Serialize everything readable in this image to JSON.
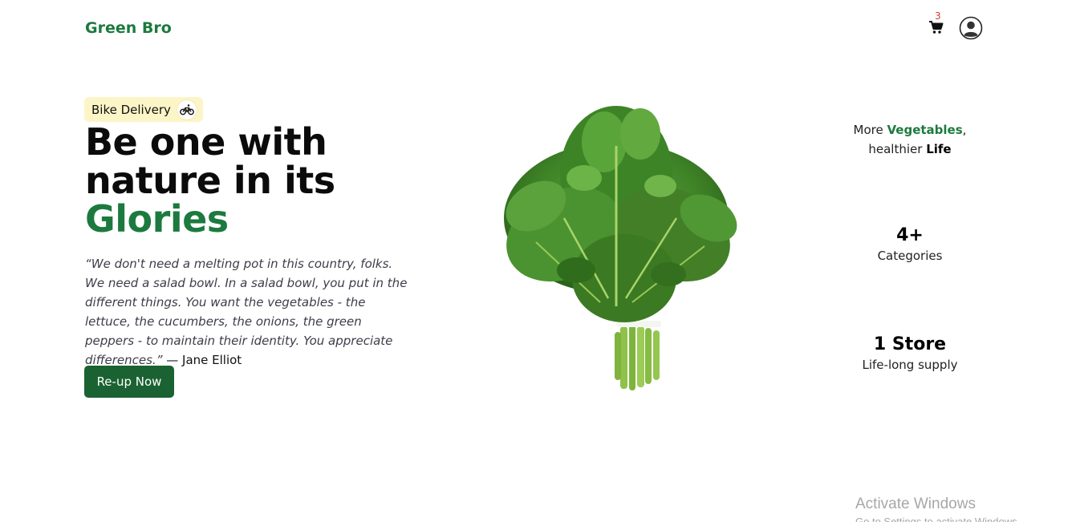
{
  "header": {
    "logo": "Green Bro",
    "cart_count": "3"
  },
  "hero": {
    "badge_label": "Bike Delivery",
    "headline_line1": "Be one with",
    "headline_line2": "nature in its",
    "headline_highlight": "Glories",
    "quote_text": "“We don't need a melting pot in this country, folks. We need a salad bowl. In a salad bowl, you put in the different things. You want the vegetables - the lettuce, the cucumbers, the onions, the green peppers - to maintain their identity. You appreciate differences.”",
    "quote_author": " — Jane Elliot",
    "cta_label": "Re-up Now"
  },
  "stats": {
    "tagline_pre": "More ",
    "tagline_veg": "Vegetables",
    "tagline_mid": ",",
    "tagline_line2": "healthier ",
    "tagline_life": "Life",
    "categories_value": "4+",
    "categories_label": "Categories",
    "store_value": "1 Store",
    "store_label": "Life-long supply"
  },
  "watermark": {
    "title": "Activate Windows",
    "subtitle": "Go to Settings to activate Windows."
  },
  "colors": {
    "brand_green": "#1c7a3e",
    "button_green": "#1a6232",
    "badge_bg": "#fcf5c7",
    "cart_badge": "#d23b2f"
  },
  "icons": {
    "cart": "shopping-cart-icon",
    "avatar": "user-circle-icon",
    "bike": "bicycle-icon"
  }
}
